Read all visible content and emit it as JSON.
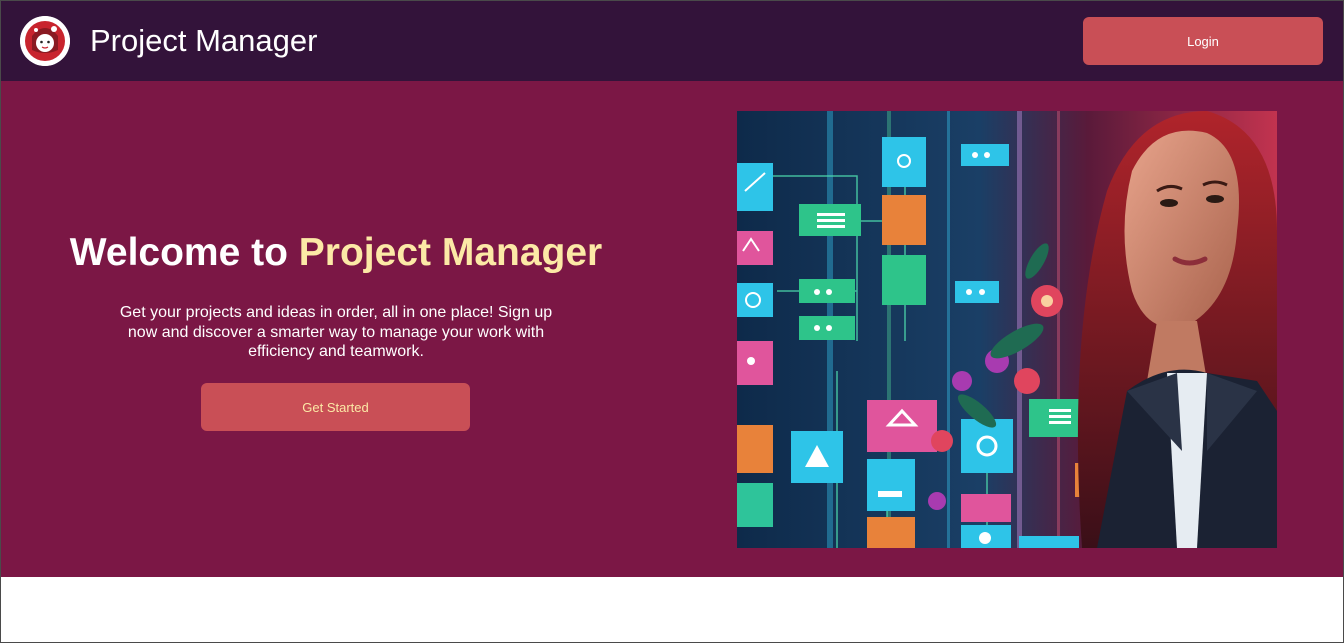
{
  "header": {
    "brand": "Project Manager",
    "login_label": "Login"
  },
  "hero": {
    "title_prefix": "Welcome to ",
    "title_accent": "Project Manager",
    "description": "Get your projects and ideas in order, all in one place! Sign up now and discover a smarter way to manage your work with efficiency and teamwork.",
    "cta_label": "Get Started"
  },
  "colors": {
    "navbar": "#33133a",
    "hero_bg": "#7b1745",
    "button": "#c94f56",
    "accent": "#fce9a6"
  },
  "icons": [
    "avatar-logo-icon"
  ]
}
